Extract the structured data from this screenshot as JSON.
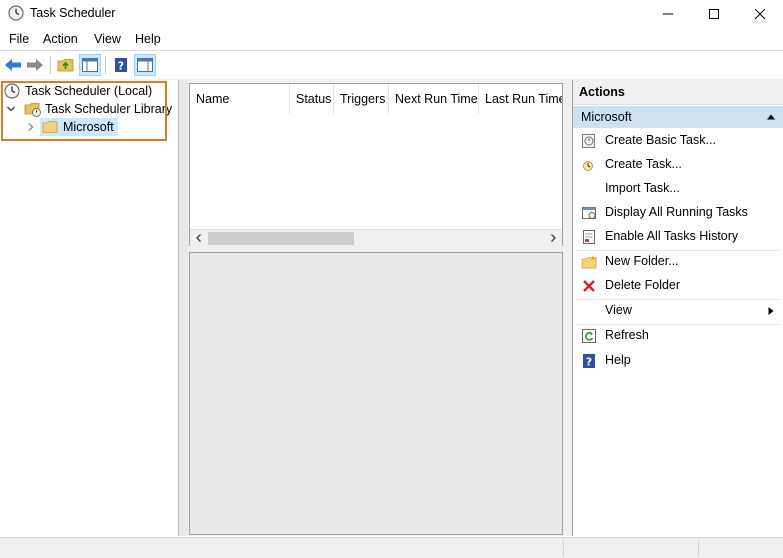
{
  "window": {
    "title": "Task Scheduler",
    "minimize_glyph": "—",
    "maximize_glyph": "☐",
    "close_glyph": "✕"
  },
  "menu": [
    "File",
    "Action",
    "View",
    "Help"
  ],
  "tree": {
    "root": "Task Scheduler (Local)",
    "library": "Task Scheduler Library",
    "child": "Microsoft"
  },
  "task_list": {
    "columns": [
      "Name",
      "Status",
      "Triggers",
      "Next Run Time",
      "Last Run Time"
    ]
  },
  "actions": {
    "header": "Actions",
    "section": "Microsoft",
    "items": [
      {
        "label": "Create Basic Task...",
        "icon": "create-basic-task-icon"
      },
      {
        "label": "Create Task...",
        "icon": "create-task-icon"
      },
      {
        "label": "Import Task...",
        "icon": ""
      },
      {
        "label": "Display All Running Tasks",
        "icon": "running-tasks-icon"
      },
      {
        "label": "Enable All Tasks History",
        "icon": "history-icon"
      },
      {
        "label": "New Folder...",
        "icon": "new-folder-icon"
      },
      {
        "label": "Delete Folder",
        "icon": "delete-icon"
      },
      {
        "label": "View",
        "icon": ""
      },
      {
        "label": "Refresh",
        "icon": "refresh-icon"
      },
      {
        "label": "Help",
        "icon": "help-icon"
      }
    ]
  },
  "colors": {
    "accent_highlight": "#e07a2a",
    "section_bg": "#cfe0ef",
    "selected_bg": "#cce8ff"
  }
}
